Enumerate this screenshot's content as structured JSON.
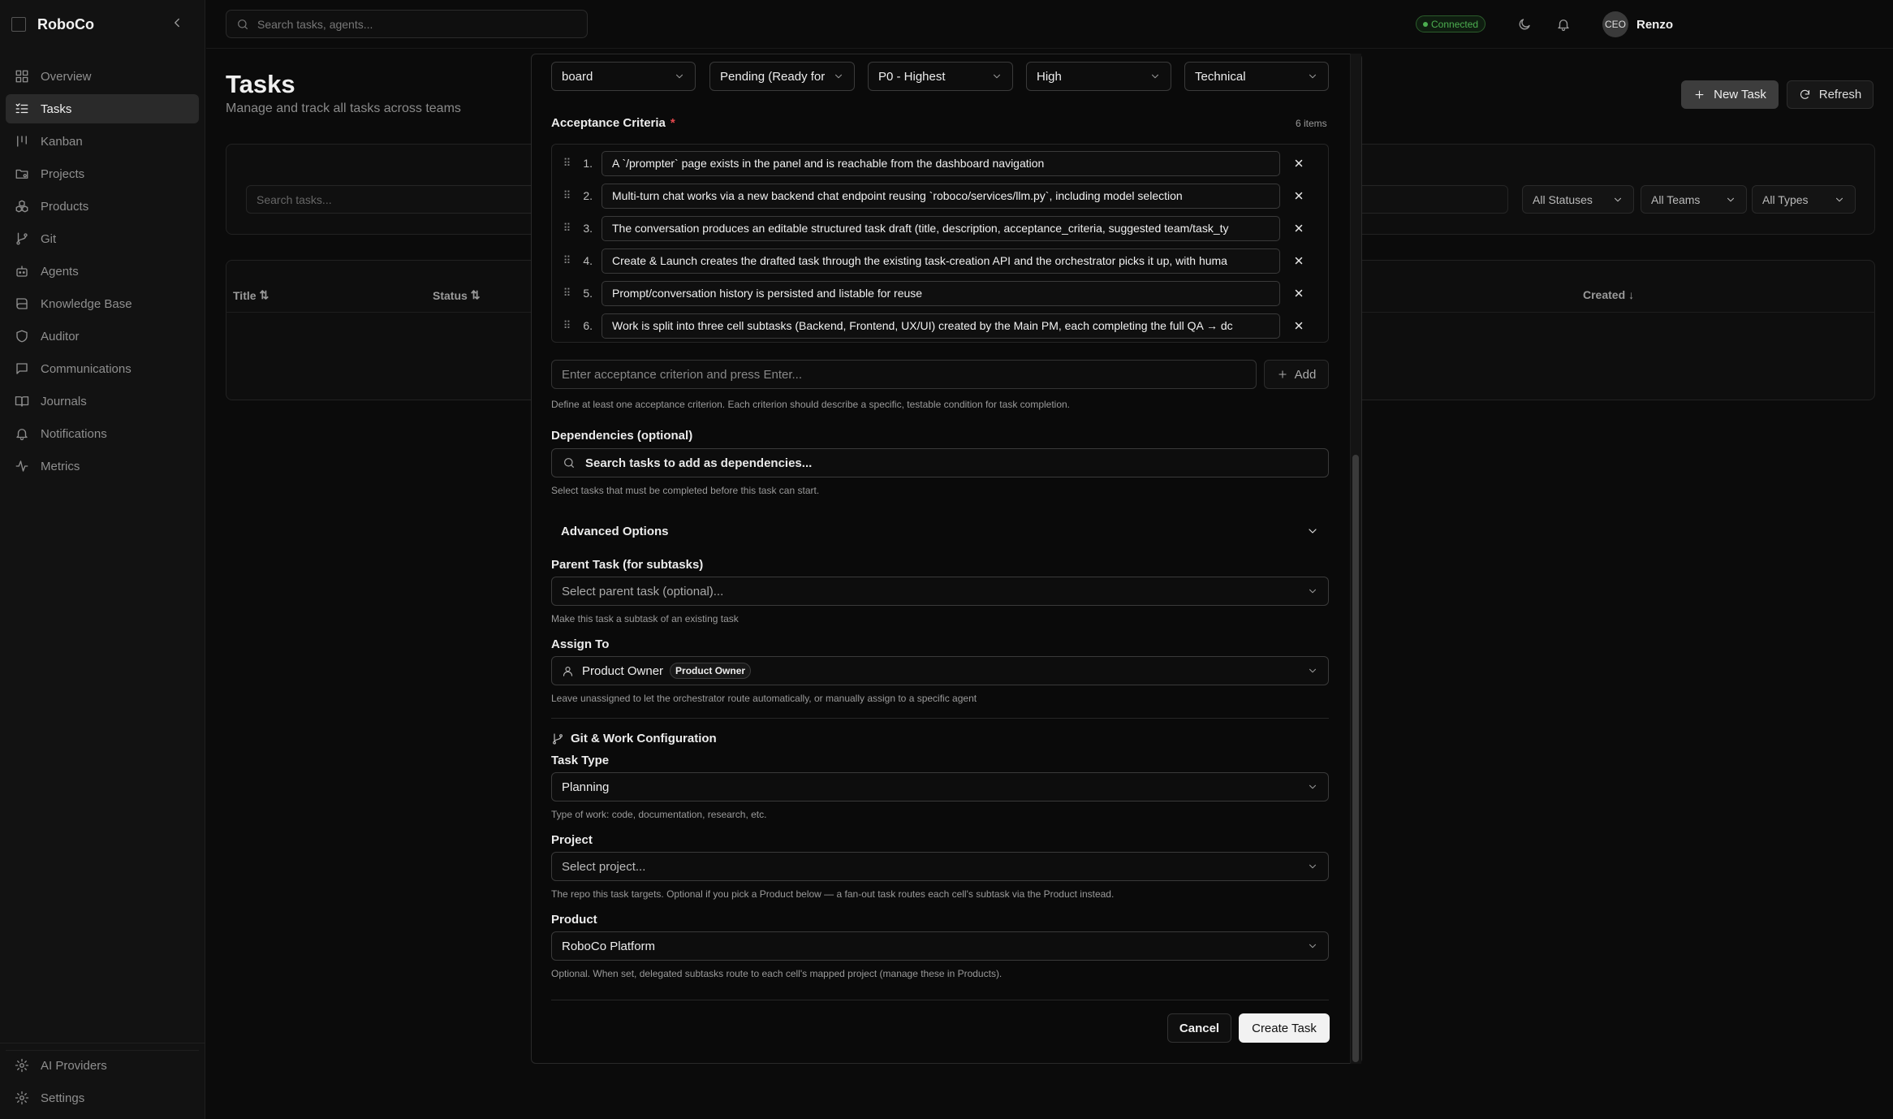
{
  "app": {
    "name": "RoboCo"
  },
  "search": {
    "placeholder": "Search tasks, agents..."
  },
  "status": {
    "connection": "Connected"
  },
  "user": {
    "initials": "CEO",
    "name": "Renzo"
  },
  "sidebar": {
    "items": [
      {
        "label": "Overview",
        "icon": "grid-icon"
      },
      {
        "label": "Tasks",
        "icon": "tasks-icon",
        "active": true
      },
      {
        "label": "Kanban",
        "icon": "kanban-icon"
      },
      {
        "label": "Projects",
        "icon": "folder-icon"
      },
      {
        "label": "Products",
        "icon": "boxes-icon"
      },
      {
        "label": "Git",
        "icon": "git-branch-icon"
      },
      {
        "label": "Agents",
        "icon": "bot-icon"
      },
      {
        "label": "Knowledge Base",
        "icon": "book-icon"
      },
      {
        "label": "Auditor",
        "icon": "shield-icon"
      },
      {
        "label": "Communications",
        "icon": "message-icon"
      },
      {
        "label": "Journals",
        "icon": "book-open-icon"
      },
      {
        "label": "Notifications",
        "icon": "bell-icon"
      },
      {
        "label": "Metrics",
        "icon": "activity-icon"
      }
    ],
    "bottom": [
      {
        "label": "AI Providers",
        "icon": "gear-icon"
      },
      {
        "label": "Settings",
        "icon": "gear-icon"
      }
    ]
  },
  "page": {
    "title": "Tasks",
    "subtitle": "Manage and track all tasks across teams",
    "new_task": "New Task",
    "refresh": "Refresh",
    "search_placeholder": "Search tasks...",
    "filters": [
      "All Statuses",
      "All Teams",
      "All Types"
    ],
    "columns": {
      "title": "Title",
      "status": "Status",
      "created": "Created"
    }
  },
  "modal": {
    "top_selects": [
      "board",
      "Pending (Ready for",
      "P0 - Highest",
      "High",
      "Technical"
    ],
    "criteria": {
      "label": "Acceptance Criteria",
      "required": "*",
      "count": "6 items",
      "items": [
        "A `/prompter` page exists in the panel and is reachable from the dashboard navigation",
        "Multi-turn chat works via a new backend chat endpoint reusing `roboco/services/llm.py`, including model selection",
        "The conversation produces an editable structured task draft (title, description, acceptance_criteria, suggested team/task_ty",
        "Create & Launch creates the drafted task through the existing task-creation API and the orchestrator picks it up, with huma",
        "Prompt/conversation history is persisted and listable for reuse",
        "Work is split into three cell subtasks (Backend, Frontend, UX/UI) created by the Main PM, each completing the full QA → dc"
      ],
      "input_placeholder": "Enter acceptance criterion and press Enter...",
      "add": "Add",
      "help": "Define at least one acceptance criterion. Each criterion should describe a specific, testable condition for task completion."
    },
    "dependencies": {
      "label": "Dependencies (optional)",
      "placeholder": "Search tasks to add as dependencies...",
      "help": "Select tasks that must be completed before this task can start."
    },
    "advanced": {
      "label": "Advanced Options"
    },
    "parent": {
      "label": "Parent Task (for subtasks)",
      "placeholder": "Select parent task (optional)...",
      "help": "Make this task a subtask of an existing task"
    },
    "assign": {
      "label": "Assign To",
      "value": "Product Owner",
      "badge": "Product Owner",
      "help": "Leave unassigned to let the orchestrator route automatically, or manually assign to a specific agent"
    },
    "git_section": {
      "label": "Git & Work Configuration"
    },
    "task_type": {
      "label": "Task Type",
      "value": "Planning",
      "help": "Type of work: code, documentation, research, etc."
    },
    "project": {
      "label": "Project",
      "placeholder": "Select project...",
      "help": "The repo this task targets. Optional if you pick a Product below — a fan-out task routes each cell's subtask via the Product instead."
    },
    "product": {
      "label": "Product",
      "value": "RoboCo Platform",
      "help": "Optional. When set, delegated subtasks route to each cell's mapped project (manage these in Products)."
    },
    "cancel": "Cancel",
    "create": "Create Task"
  },
  "colors": {
    "accent": "#f2f2f2",
    "connected": "#4caf50",
    "required": "#e5484d",
    "background": "#0b0b0b"
  }
}
